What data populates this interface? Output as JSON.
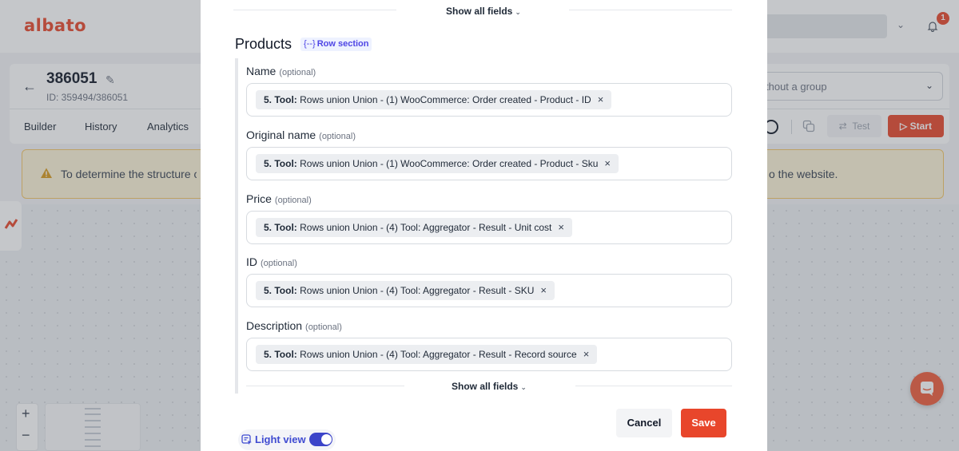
{
  "app": {
    "logo_text": "albato",
    "notification_count": "1"
  },
  "scenario": {
    "name": "386051",
    "id_text": "ID: 359494/386051"
  },
  "nav_tabs": [
    "Builder",
    "History",
    "Analytics"
  ],
  "group_select": {
    "value": "thout a group"
  },
  "toolbar": {
    "test_label": "Test",
    "start_label": "Start"
  },
  "warning": {
    "text_left": "To determine the structure c",
    "text_right": "o the website."
  },
  "modal": {
    "show_all_fields_label": "Show all fields",
    "section": {
      "title": "Products",
      "badge": "Row section",
      "badge_icon": "{--}"
    },
    "optional_text": "(optional)",
    "fields": [
      {
        "label": "Name",
        "chip_prefix": "5. Tool:",
        "chip_text": "Rows union Union - (1) WooCommerce: Order created - Product - ID"
      },
      {
        "label": "Original name",
        "chip_prefix": "5. Tool:",
        "chip_text": "Rows union Union - (1) WooCommerce: Order created - Product - Sku"
      },
      {
        "label": "Price",
        "chip_prefix": "5. Tool:",
        "chip_text": "Rows union Union - (4) Tool: Aggregator - Result - Unit cost"
      },
      {
        "label": "ID",
        "chip_prefix": "5. Tool:",
        "chip_text": "Rows union Union - (4) Tool: Aggregator - Result - SKU"
      },
      {
        "label": "Description",
        "chip_prefix": "5. Tool:",
        "chip_text": "Rows union Union - (4) Tool: Aggregator - Result - Record source"
      }
    ],
    "cancel_label": "Cancel",
    "save_label": "Save",
    "light_view_label": "Light view",
    "light_view_on": true
  },
  "colors": {
    "brand": "#e8462b",
    "accent": "#3b44c9",
    "warning_bg": "#fdf3d7"
  }
}
